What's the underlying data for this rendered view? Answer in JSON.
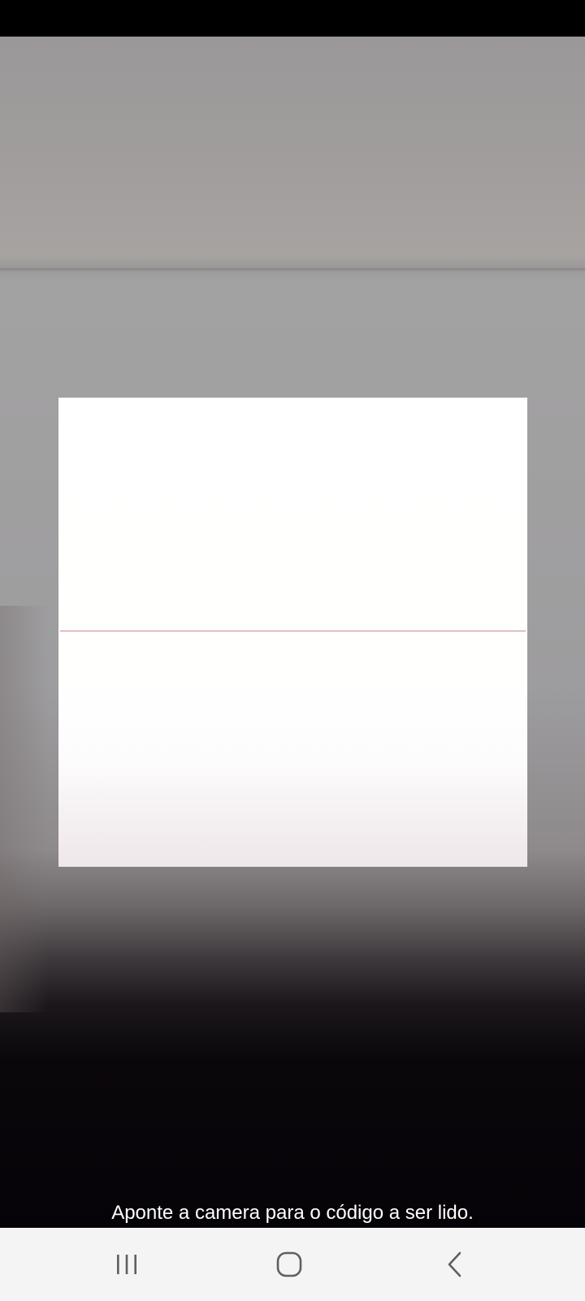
{
  "scanner": {
    "hint": "Aponte a camera para o código a ser lido.",
    "scan_line_color": "#e3bfc6"
  },
  "navigation": {
    "recents_icon": "recent-apps-icon",
    "home_icon": "home-icon",
    "back_icon": "back-chevron-icon"
  }
}
